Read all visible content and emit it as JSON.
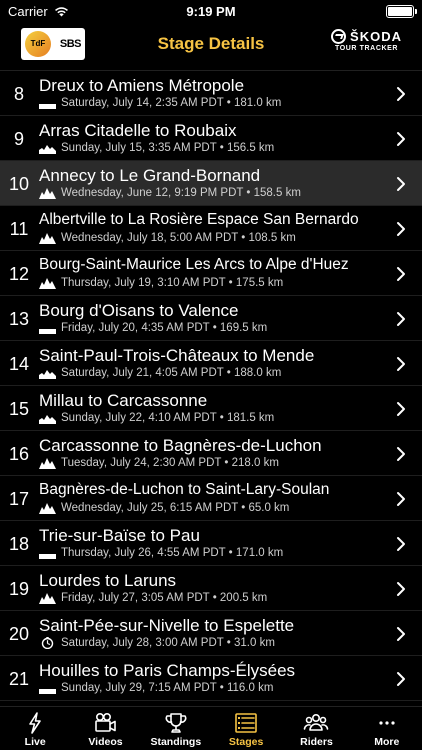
{
  "status_bar": {
    "carrier": "Carrier",
    "time": "9:19 PM"
  },
  "nav": {
    "title": "Stage Details",
    "left_logo": {
      "tdf": "Tour de France",
      "partner": "SBS"
    },
    "right_logo": {
      "brand": "ŠKODA",
      "sub": "TOUR TRACKER"
    }
  },
  "stages": [
    {
      "number": "8",
      "title": "Dreux to Amiens Métropole",
      "date": "Saturday, July 14, 2:35 AM PDT • 181.0 km",
      "profile": "flat-icon",
      "active": false
    },
    {
      "number": "9",
      "title": "Arras Citadelle to Roubaix",
      "date": "Sunday, July 15, 3:35 AM PDT • 156.5 km",
      "profile": "hilly-icon",
      "active": false
    },
    {
      "number": "10",
      "title": "Annecy to Le Grand-Bornand",
      "date": "Wednesday, June 12, 9:19 PM PDT • 158.5 km",
      "profile": "mountain-icon",
      "active": true
    },
    {
      "number": "11",
      "title": "Albertville to La Rosière Espace San Bernardo",
      "date": "Wednesday, July 18, 5:00 AM PDT • 108.5 km",
      "profile": "mountain-icon",
      "active": false
    },
    {
      "number": "12",
      "title": "Bourg-Saint-Maurice Les Arcs to Alpe d'Huez",
      "date": "Thursday, July 19, 3:10 AM PDT • 175.5 km",
      "profile": "mountain-icon",
      "active": false
    },
    {
      "number": "13",
      "title": "Bourg d'Oisans to Valence",
      "date": "Friday, July 20, 4:35 AM PDT • 169.5 km",
      "profile": "flat-icon",
      "active": false
    },
    {
      "number": "14",
      "title": "Saint-Paul-Trois-Châteaux to Mende",
      "date": "Saturday, July 21, 4:05 AM PDT • 188.0 km",
      "profile": "hilly-icon",
      "active": false
    },
    {
      "number": "15",
      "title": "Millau to Carcassonne",
      "date": "Sunday, July 22, 4:10 AM PDT • 181.5 km",
      "profile": "hilly-icon",
      "active": false
    },
    {
      "number": "16",
      "title": "Carcassonne to Bagnères-de-Luchon",
      "date": "Tuesday, July 24, 2:30 AM PDT • 218.0 km",
      "profile": "mountain-icon",
      "active": false
    },
    {
      "number": "17",
      "title": "Bagnères-de-Luchon to Saint-Lary-Soulan",
      "date": "Wednesday, July 25, 6:15 AM PDT • 65.0 km",
      "profile": "mountain-icon",
      "active": false
    },
    {
      "number": "18",
      "title": "Trie-sur-Baïse to Pau",
      "date": "Thursday, July 26, 4:55 AM PDT • 171.0 km",
      "profile": "flat-icon",
      "active": false
    },
    {
      "number": "19",
      "title": "Lourdes to Laruns",
      "date": "Friday, July 27, 3:05 AM PDT • 200.5 km",
      "profile": "mountain-icon",
      "active": false
    },
    {
      "number": "20",
      "title": "Saint-Pée-sur-Nivelle to Espelette",
      "date": "Saturday, July 28, 3:00 AM PDT • 31.0 km",
      "profile": "time-trial-icon",
      "active": false
    },
    {
      "number": "21",
      "title": "Houilles to Paris Champs-Élysées",
      "date": "Sunday, July 29, 7:15 AM PDT • 116.0 km",
      "profile": "flat-icon",
      "active": false
    }
  ],
  "tabs": [
    {
      "label": "Live",
      "icon": "lightning-icon",
      "active": false
    },
    {
      "label": "Videos",
      "icon": "video-camera-icon",
      "active": false
    },
    {
      "label": "Standings",
      "icon": "trophy-icon",
      "active": false
    },
    {
      "label": "Stages",
      "icon": "list-icon",
      "active": true
    },
    {
      "label": "Riders",
      "icon": "riders-icon",
      "active": false
    },
    {
      "label": "More",
      "icon": "more-icon",
      "active": false
    }
  ],
  "colors": {
    "accent": "#f6c344",
    "background": "#000000",
    "active_row": "#2b2b2b"
  }
}
